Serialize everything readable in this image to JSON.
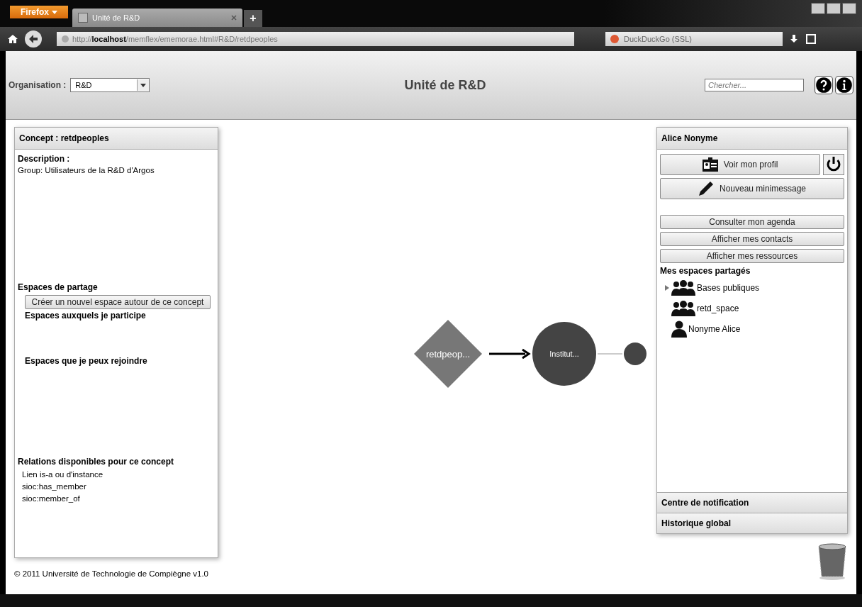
{
  "browser": {
    "menu": "Firefox",
    "tab_title": "Unité de R&D",
    "new_tab": "+",
    "url": "http://**localhost**/memflex/ememorae.html#R&D/retdpeoples",
    "search_engine": "DuckDuckGo (SSL)"
  },
  "header": {
    "org_label": "Organisation :",
    "org_value": "R&D",
    "title": "Unité de R&D",
    "search": {
      "placeholder": "Chercher..."
    }
  },
  "concept_panel": {
    "title": "Concept : retdpeoples",
    "description_label": "Description :",
    "description": "Group: Utilisateurs de la R&D d'Argos",
    "sharing_heading": "Espaces de partage",
    "create_button": "Créer un nouvel espace autour de ce concept",
    "joined_heading": "Espaces auxquels je participe",
    "joinable_heading": "Espaces que je peux rejoindre",
    "relations_heading": "Relations disponibles pour ce concept",
    "relations": [
      "Lien is-a ou d'instance",
      "sioc:has_member",
      "sioc:member_of"
    ]
  },
  "graph": {
    "nodes": [
      {
        "kind": "diamond",
        "label": "retdpeop..."
      },
      {
        "kind": "circle",
        "label": "Institut..."
      },
      {
        "kind": "small"
      }
    ],
    "edges": [
      {
        "kind": "arrow"
      },
      {
        "kind": "line"
      }
    ]
  },
  "user_panel": {
    "title": "Alice Nonyme",
    "profile_button": "Voir mon profil",
    "message_button": "Nouveau minimessage",
    "buttons": [
      "Consulter mon agenda",
      "Afficher mes contacts",
      "Afficher mes ressources"
    ],
    "spaces_heading": "Mes espaces partagés",
    "spaces": [
      {
        "kind": "group",
        "label": "Bases publiques",
        "expanded": false
      },
      {
        "kind": "group",
        "label": "retd_space"
      },
      {
        "kind": "person",
        "label": "Nonyme Alice"
      }
    ],
    "notifications": "Centre de notification",
    "history": "Historique global"
  },
  "footer": "© 2011 Université de Technologie de Compiègne v1.0"
}
